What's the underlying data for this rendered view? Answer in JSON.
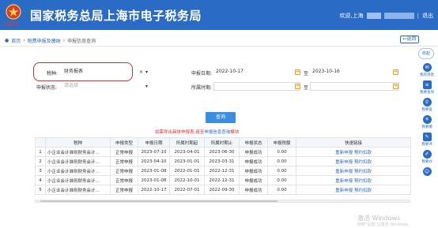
{
  "header": {
    "logo_text": "中国税务",
    "title": "国家税务总局上海市电子税务局",
    "welcome": "欢迎,上海",
    "divider": "|",
    "logout": "退出"
  },
  "breadcrumb": {
    "home": "首页",
    "level1": "税费申报及缴纳",
    "level2": "申报信息查询",
    "back": "返回"
  },
  "form": {
    "tax_label": "税种:",
    "tax_value": "财务报表",
    "status_label": "申报状态:",
    "status_placeholder": "请选择",
    "date_label": "申报日期:",
    "date_from": "2022-10-17",
    "date_to": "2023-10-16",
    "to_label": "至",
    "period_label": "所属时期:",
    "query": "查询"
  },
  "hint": {
    "prefix": "如需导出具体申报表,请至",
    "link": "申报信息查询",
    "suffix": "模块"
  },
  "table": {
    "headers": [
      "",
      "税种",
      "申报类型",
      "申报日期",
      "所属时期起",
      "所属时期止",
      "申报状态",
      "申报税额",
      "快速链接"
    ],
    "actions": [
      "重新申报",
      "预约扣款"
    ],
    "rows": [
      {
        "no": "1",
        "tax": "小企业会计准则财务会计...",
        "type": "正常申报",
        "date": "2023-07-10",
        "start": "2023-04-01",
        "end": "2023-06-30",
        "status": "申报成功",
        "amount": "0.00"
      },
      {
        "no": "2",
        "tax": "小企业会计准则财务会计...",
        "type": "正常申报",
        "date": "2023-04-10",
        "start": "2023-01-01",
        "end": "2023-03-31",
        "status": "申报成功",
        "amount": "0.00"
      },
      {
        "no": "3",
        "tax": "小企业会计准则财务会计...",
        "type": "正常申报",
        "date": "2023-01-08",
        "start": "2022-01-01",
        "end": "2022-12-31",
        "status": "申报成功",
        "amount": "0.00"
      },
      {
        "no": "4",
        "tax": "小企业会计准则财务会计...",
        "type": "正常申报",
        "date": "2023-01-08",
        "start": "2022-10-01",
        "end": "2022-12-31",
        "status": "申报成功",
        "amount": "0.00"
      },
      {
        "no": "5",
        "tax": "小企业会计准则财务会计...",
        "type": "正常申报",
        "date": "2022-10-17",
        "start": "2022-07-01",
        "end": "2022-09-30",
        "status": "申报成功",
        "amount": "0.00"
      }
    ]
  },
  "sidebar": {
    "collapse": "收起",
    "items": [
      "我的消息",
      "我要查询",
      "我要查",
      "我要缴",
      "我要评",
      "我要办"
    ]
  },
  "watermark": {
    "line1": "激活 Windows",
    "line2": "转到\"设置\"以激活 Windows。"
  },
  "colors": {
    "header_bg": "#2a6bc6",
    "accent": "#2a6bc6",
    "annotation": "#c0392b",
    "hint": "#e0302f"
  }
}
